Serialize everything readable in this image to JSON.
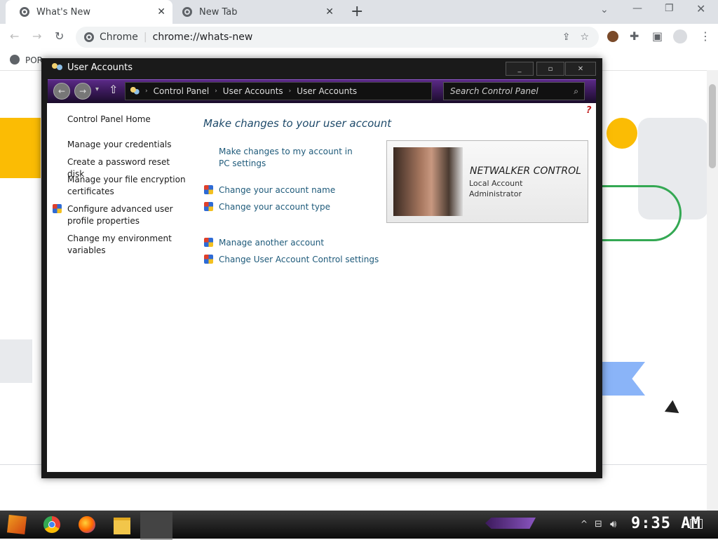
{
  "browser": {
    "tabs": [
      {
        "title": "What's New"
      },
      {
        "title": "New Tab"
      }
    ],
    "new_tab": "+",
    "site_label": "Chrome",
    "url": "chrome://whats-new",
    "bookmark_partial": "POR"
  },
  "dialog": {
    "title": "User Accounts",
    "breadcrumb": [
      "Control Panel",
      "User Accounts",
      "User Accounts"
    ],
    "search_placeholder": "Search Control Panel",
    "help": "?",
    "sidebar": {
      "home": "Control Panel Home",
      "links": [
        "Manage your credentials",
        "Create a password reset disk",
        "Manage your file encryption certificates",
        "Configure advanced user profile properties",
        "Change my environment variables"
      ]
    },
    "heading": "Make changes to your user account",
    "links_group1": [
      "Make changes to my account in PC settings",
      "Change your account name",
      "Change your account type"
    ],
    "links_group2": [
      "Manage another account",
      "Change User Account Control settings"
    ],
    "account": {
      "name": "NETWALKER CONTROL",
      "type": "Local Account",
      "role": "Administrator"
    }
  },
  "taskbar": {
    "clock": "9:35 AM"
  },
  "colors": {
    "accent_purple": "#5a2a86",
    "link_color": "#1e5a7a",
    "chrome_tab_bg": "#dee1e6"
  }
}
